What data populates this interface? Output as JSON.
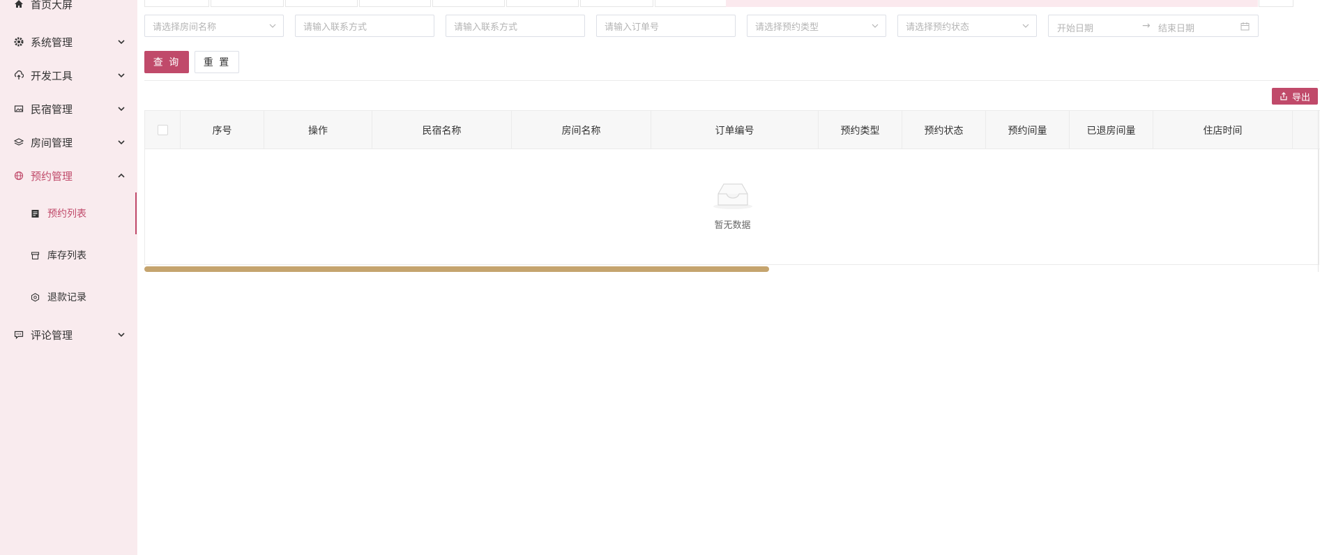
{
  "sidebar": {
    "items": [
      {
        "label": "首页大屏",
        "icon": "home-icon"
      },
      {
        "label": "系统管理",
        "icon": "gear-icon"
      },
      {
        "label": "开发工具",
        "icon": "cloud-upload-icon"
      },
      {
        "label": "民宿管理",
        "icon": "image-icon"
      },
      {
        "label": "房间管理",
        "icon": "layers-icon"
      },
      {
        "label": "预约管理",
        "icon": "globe-icon"
      },
      {
        "label": "评论管理",
        "icon": "comment-icon"
      }
    ],
    "sub_items": [
      {
        "label": "预约列表",
        "icon": "document-icon"
      },
      {
        "label": "库存列表",
        "icon": "box-icon"
      },
      {
        "label": "退款记录",
        "icon": "hexagon-icon"
      }
    ]
  },
  "filters": {
    "room_name_placeholder": "请选择房间名称",
    "contact1_placeholder": "请输入联系方式",
    "contact2_placeholder": "请输入联系方式",
    "order_no_placeholder": "请输入订单号",
    "booking_type_placeholder": "请选择预约类型",
    "booking_status_placeholder": "请选择预约状态",
    "start_date_placeholder": "开始日期",
    "date_separator": "→",
    "end_date_placeholder": "结束日期"
  },
  "actions": {
    "query_label": "查 询",
    "reset_label": "重 置",
    "export_label": "导出"
  },
  "table": {
    "columns": [
      "序号",
      "操作",
      "民宿名称",
      "房间名称",
      "订单编号",
      "预约类型",
      "预约状态",
      "预约间量",
      "已退房间量",
      "住店时间"
    ],
    "empty_text": "暂无数据"
  },
  "colors": {
    "accent": "#c04a6a",
    "sidebar_bg": "#f9ebee",
    "scrollbar": "#c5a46e"
  }
}
